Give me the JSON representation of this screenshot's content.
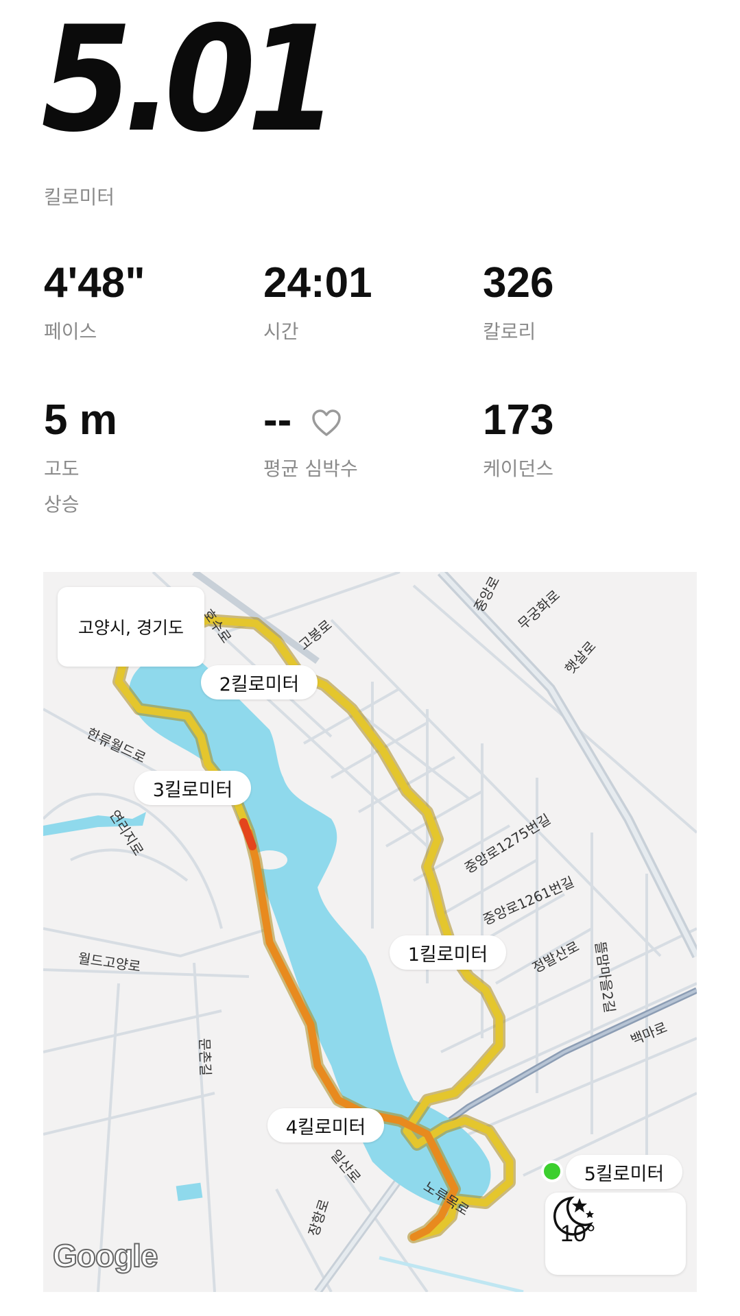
{
  "summary": {
    "distance": "5.01",
    "distance_unit": "킬로미터"
  },
  "stats": {
    "pace": {
      "value": "4'48\"",
      "label": "페이스"
    },
    "time": {
      "value": "24:01",
      "label": "시간"
    },
    "calories": {
      "value": "326",
      "label": "칼로리"
    },
    "elevation": {
      "value": "5 m",
      "label": "고도",
      "sublabel": "상승"
    },
    "heart_rate": {
      "value": "--",
      "label": "평균 심박수"
    },
    "cadence": {
      "value": "173",
      "label": "케이던스"
    }
  },
  "map": {
    "location": "고양시, 경기도",
    "km_markers": [
      "1킬로미터",
      "2킬로미터",
      "3킬로미터",
      "4킬로미터",
      "5킬로미터"
    ],
    "road_labels": [
      "호수로",
      "고봉로",
      "중앙로",
      "무궁화로",
      "햇살로",
      "한류월드로",
      "연리지로",
      "중앙로1275번길",
      "중앙로1261번길",
      "정발산로",
      "뜰맘마을2길",
      "백마로",
      "월드고양로",
      "문촌길",
      "일산로",
      "노루목로",
      "장항로"
    ],
    "weather": {
      "temperature": "10°",
      "icon": "moon-stars-icon"
    },
    "attribution": "Google",
    "colors": {
      "water": "#8fd9ec",
      "route_yellow": "#e4c62d",
      "route_orange": "#e88a1e",
      "route_red": "#e4451c",
      "start_dot": "#3ccf2e"
    }
  }
}
